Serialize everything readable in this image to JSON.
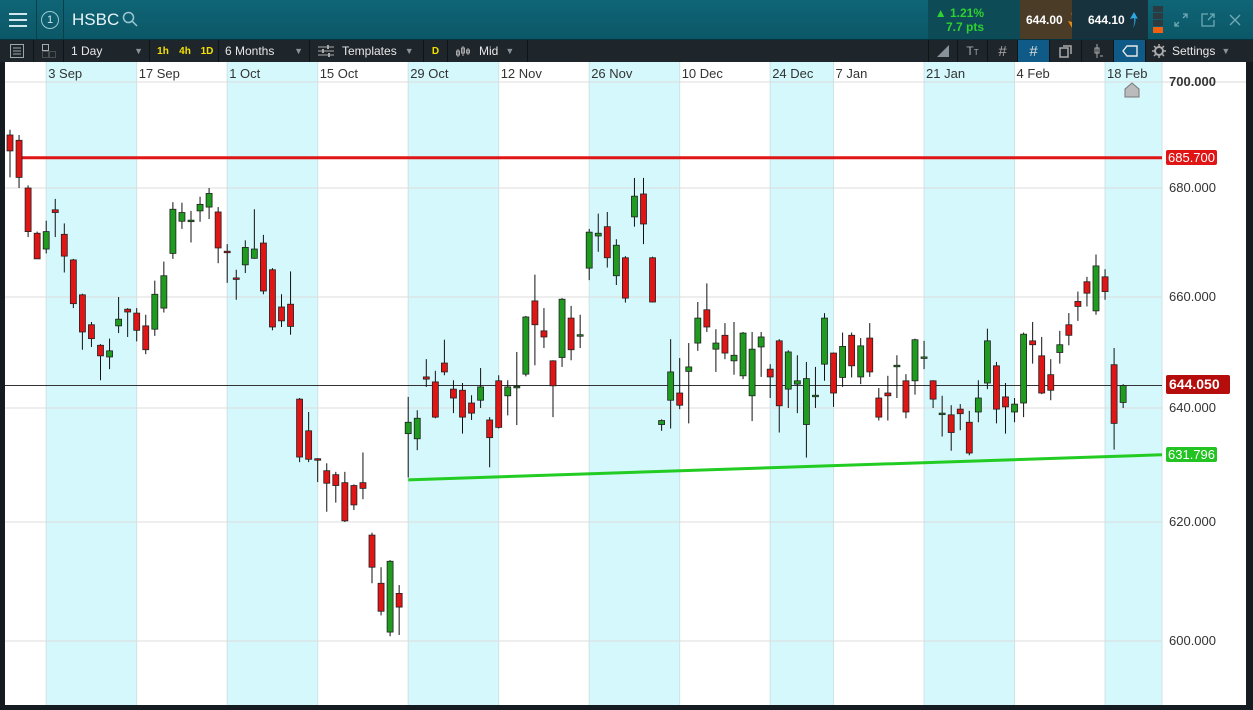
{
  "header": {
    "symbol": "HSBC",
    "window_number": "1",
    "change_percent": "▲ 1.21%",
    "change_points": "7.7 pts",
    "sell_price": "644.00",
    "buy_price": "644.10"
  },
  "toolbar": {
    "interval": "1 Day",
    "quick_intervals": [
      "1h",
      "4h",
      "1D"
    ],
    "range": "6 Months",
    "templates_label": "Templates",
    "d_label": "D",
    "price_type": "Mid",
    "settings_label": "Settings"
  },
  "colors": {
    "up": "#1f9b1f",
    "down": "#e01515",
    "resistance": "#e01515",
    "support": "#22cc22",
    "shade": "#d4f8fb"
  },
  "chart_data": {
    "type": "candlestick",
    "symbol": "HSBC",
    "x_labels": [
      {
        "label": "3 Sep",
        "index": 4
      },
      {
        "label": "17 Sep",
        "index": 14
      },
      {
        "label": "1 Oct",
        "index": 24
      },
      {
        "label": "15 Oct",
        "index": 34
      },
      {
        "label": "29 Oct",
        "index": 44
      },
      {
        "label": "12 Nov",
        "index": 54
      },
      {
        "label": "26 Nov",
        "index": 64
      },
      {
        "label": "10 Dec",
        "index": 74
      },
      {
        "label": "24 Dec",
        "index": 84
      },
      {
        "label": "7 Jan",
        "index": 91
      },
      {
        "label": "21 Jan",
        "index": 101
      },
      {
        "label": "4 Feb",
        "index": 111
      },
      {
        "label": "18 Feb",
        "index": 121
      }
    ],
    "y_ticks": [
      "700.000",
      "680.000",
      "660.000",
      "640.000",
      "620.000",
      "600.000"
    ],
    "ylim": [
      590,
      705
    ],
    "last_price": "644.050",
    "resistance": {
      "price": 685.7,
      "label": "685.700",
      "start_index": 1
    },
    "support": {
      "start_index": 44,
      "start_price": 627.4,
      "end_price": 631.796,
      "label": "631.796"
    },
    "ohlc": [
      [
        690,
        691,
        682,
        687
      ],
      [
        689,
        690,
        680,
        682
      ],
      [
        680,
        680.5,
        671,
        672
      ],
      [
        671.7,
        672,
        667,
        667
      ],
      [
        668.8,
        674,
        668,
        672
      ],
      [
        676,
        678,
        671,
        675.5
      ],
      [
        671.5,
        673.5,
        664.5,
        667.5
      ],
      [
        666.8,
        667,
        658,
        658.8
      ],
      [
        660.4,
        660.6,
        650.5,
        653.7
      ],
      [
        655,
        655.5,
        651,
        652.5
      ],
      [
        651.3,
        651.5,
        645,
        649.4
      ],
      [
        649.2,
        652.5,
        647,
        650.3
      ],
      [
        654.8,
        660,
        653.5,
        656
      ],
      [
        657.8,
        658,
        652.8,
        657.3
      ],
      [
        657.1,
        658,
        652,
        654
      ],
      [
        654.8,
        656.8,
        649.7,
        650.5
      ],
      [
        654.2,
        663,
        653,
        660.5
      ],
      [
        658,
        666.5,
        657.2,
        663.9
      ],
      [
        668,
        677.4,
        667,
        676.1
      ],
      [
        673.9,
        677.3,
        672.5,
        675.5
      ],
      [
        674,
        675.8,
        670,
        674.1
      ],
      [
        675.8,
        678.4,
        673.8,
        677
      ],
      [
        676.5,
        680,
        674.3,
        679
      ],
      [
        675.6,
        676.5,
        666.2,
        669
      ],
      [
        668.4,
        669.7,
        662.6,
        668.3
      ],
      [
        663.5,
        665,
        659.5,
        663.4
      ],
      [
        665.9,
        670.4,
        664.4,
        669.1
      ],
      [
        667.1,
        676.1,
        667,
        668.8
      ],
      [
        669.9,
        671.4,
        660.5,
        661.1
      ],
      [
        665,
        665.3,
        654,
        654.6
      ],
      [
        658.2,
        660.5,
        654.6,
        655.7
      ],
      [
        658.7,
        664.7,
        653.2,
        654.7
      ],
      [
        641.6,
        641.8,
        630.5,
        631.4
      ],
      [
        636,
        639.3,
        630.5,
        631
      ],
      [
        631.1,
        631.2,
        627,
        630.9
      ],
      [
        629,
        630.3,
        621.8,
        626.8
      ],
      [
        628.3,
        628.8,
        623.4,
        626.4
      ],
      [
        626.9,
        628.8,
        620,
        620.2
      ],
      [
        626.4,
        626.6,
        622.1,
        623
      ],
      [
        626.9,
        632.2,
        624,
        625.9
      ],
      [
        617.8,
        618.2,
        609.7,
        612.4
      ],
      [
        609.7,
        612.4,
        604.3,
        605
      ],
      [
        601.5,
        613.6,
        600.8,
        613.4
      ],
      [
        608,
        609.4,
        601,
        605.7
      ],
      [
        635.5,
        642,
        627.8,
        637.5
      ],
      [
        634.6,
        639.6,
        632.6,
        638.2
      ],
      [
        645.6,
        648.8,
        643.8,
        645.2
      ],
      [
        644.7,
        646.7,
        638.2,
        638.4
      ],
      [
        648.1,
        652.3,
        645.9,
        646.5
      ],
      [
        643.4,
        645,
        639.1,
        641.8
      ],
      [
        643.2,
        644.5,
        635.5,
        638.4
      ],
      [
        640.9,
        642.3,
        637.9,
        639.1
      ],
      [
        641.4,
        647.2,
        640,
        643.8
      ],
      [
        637.9,
        638.4,
        629.6,
        634.8
      ],
      [
        644.9,
        645.9,
        636.4,
        636.6
      ],
      [
        642.2,
        645,
        638.7,
        643.8
      ],
      [
        643.8,
        650.1,
        637,
        643.9
      ],
      [
        646.1,
        656.6,
        645.7,
        656.4
      ],
      [
        659.3,
        664.1,
        647.7,
        655
      ],
      [
        653.9,
        658,
        650.8,
        652.8
      ],
      [
        648.5,
        648.6,
        638.4,
        644
      ],
      [
        649.1,
        659.8,
        647.4,
        659.6
      ],
      [
        656.2,
        658.4,
        648.6,
        650.5
      ],
      [
        653.1,
        656.8,
        650.8,
        653.2
      ],
      [
        665.3,
        672.5,
        663.1,
        671.9
      ],
      [
        671.2,
        675.3,
        668.3,
        671.7
      ],
      [
        672.9,
        675.6,
        665.4,
        667.2
      ],
      [
        663.9,
        670.6,
        662.2,
        669.5
      ],
      [
        667.2,
        667.5,
        659,
        659.8
      ],
      [
        674.7,
        681.9,
        672.9,
        678.5
      ],
      [
        678.9,
        681.9,
        669.7,
        673.4
      ],
      [
        667.2,
        667.4,
        659,
        659.1
      ],
      [
        637.1,
        638,
        636,
        637.8
      ],
      [
        641.4,
        652.4,
        636.4,
        646.5
      ],
      [
        642.7,
        649,
        639.8,
        640.5
      ],
      [
        646.6,
        651.7,
        637.3,
        647.4
      ],
      [
        651.7,
        659.1,
        650.3,
        656.2
      ],
      [
        657.7,
        662.5,
        653.7,
        654.6
      ],
      [
        650.6,
        654.2,
        646.5,
        651.7
      ],
      [
        653.1,
        655.3,
        648.8,
        649.9
      ],
      [
        648.5,
        655.5,
        646,
        649.5
      ],
      [
        645.8,
        653.7,
        645.2,
        653.5
      ],
      [
        642.2,
        653.7,
        637.7,
        650.6
      ],
      [
        651,
        653.7,
        645.6,
        652.8
      ],
      [
        647,
        647.9,
        641.8,
        645.6
      ],
      [
        652.1,
        652.4,
        635.7,
        640.4
      ],
      [
        643.4,
        650.4,
        640,
        650.1
      ],
      [
        644.3,
        649.5,
        639.1,
        644.9
      ],
      [
        637.1,
        648.3,
        631.3,
        645.3
      ],
      [
        642.2,
        647.4,
        640,
        642.3
      ],
      [
        647.9,
        657.1,
        644.9,
        656.2
      ],
      [
        649.9,
        650,
        640.2,
        642.7
      ],
      [
        645.5,
        653.6,
        643.8,
        651.1
      ],
      [
        653.1,
        653.6,
        645.5,
        647.6
      ],
      [
        645.6,
        652.6,
        644.3,
        651.2
      ],
      [
        652.6,
        655.3,
        645.6,
        646.5
      ],
      [
        641.8,
        643.6,
        637.8,
        638.4
      ],
      [
        642.7,
        645.8,
        637.8,
        642.2
      ],
      [
        647.6,
        649.5,
        641.8,
        647.7
      ],
      [
        644.9,
        646.1,
        638.2,
        639.3
      ],
      [
        644.9,
        652.5,
        642.4,
        652.3
      ],
      [
        649.1,
        652.1,
        647,
        649.2
      ],
      [
        644.9,
        645,
        640,
        641.6
      ],
      [
        639,
        642.2,
        635,
        639.1
      ],
      [
        638.8,
        640.5,
        632.5,
        635.7
      ],
      [
        639.8,
        640.7,
        636.1,
        639
      ],
      [
        637.5,
        639.5,
        631.7,
        632.1
      ],
      [
        639.3,
        645,
        637.5,
        641.8
      ],
      [
        644.5,
        654.3,
        643.4,
        652.1
      ],
      [
        647.6,
        648.3,
        637.3,
        639.8
      ],
      [
        642,
        644.5,
        635.5,
        640.2
      ],
      [
        639.3,
        641.8,
        637.5,
        640.7
      ],
      [
        640.9,
        653.6,
        638.4,
        653.3
      ],
      [
        652.1,
        655.5,
        648,
        651.4
      ],
      [
        649.4,
        652.8,
        642.5,
        642.7
      ],
      [
        646,
        648.8,
        641.4,
        643.2
      ],
      [
        650,
        653.9,
        648,
        651.4
      ],
      [
        655,
        657.1,
        651.3,
        653.1
      ],
      [
        659.2,
        661,
        655.7,
        658.3
      ],
      [
        662.8,
        663.7,
        658.3,
        660.7
      ],
      [
        657.5,
        667.8,
        656.8,
        665.7
      ],
      [
        663.7,
        665.1,
        659.5,
        661
      ],
      [
        647.8,
        650.8,
        632.7,
        637.3
      ],
      [
        641,
        644.3,
        640,
        644.05
      ]
    ]
  }
}
